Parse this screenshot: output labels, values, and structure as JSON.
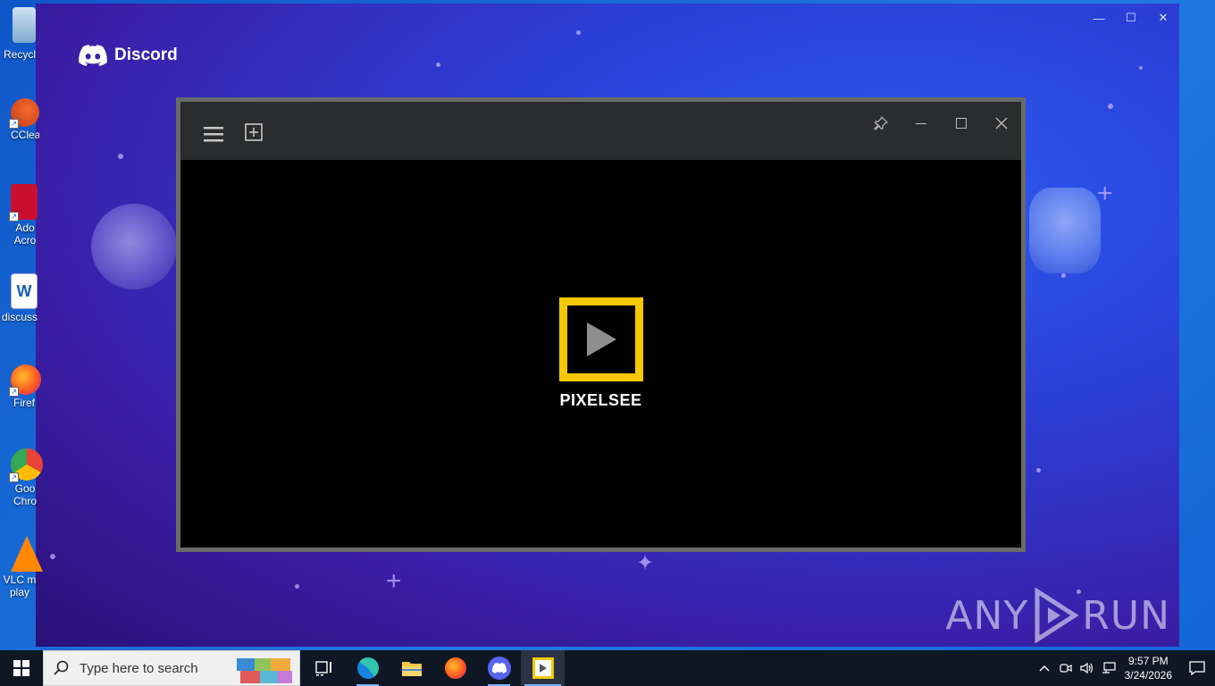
{
  "desktop": {
    "icons": [
      {
        "label": "Recycl",
        "icon": "recycle-bin-icon"
      },
      {
        "label": "CClea",
        "icon": "ccleaner-icon"
      },
      {
        "label": "Ado\nAcro",
        "icon": "acrobat-icon"
      },
      {
        "label": "discuss",
        "icon": "word-doc-icon"
      },
      {
        "label": "Firef",
        "icon": "firefox-icon"
      },
      {
        "label": "Goo\nChro",
        "icon": "chrome-icon"
      },
      {
        "label": "VLC m\nplay",
        "icon": "vlc-icon"
      }
    ]
  },
  "discord": {
    "brand": "Discord",
    "controls": {
      "minimize": "—",
      "maximize": "☐",
      "close": "✕"
    }
  },
  "pixelsee": {
    "name": "PIXELSEE",
    "accent": "#f5c800"
  },
  "watermark": {
    "text_left": "ANY",
    "text_right": "RUN"
  },
  "taskbar": {
    "search_placeholder": "Type here to search",
    "apps": [
      "task-view",
      "edge",
      "file-explorer",
      "firefox",
      "discord",
      "pixelsee"
    ],
    "clock": {
      "time": "9:57 PM",
      "date": "3/24/2026"
    }
  }
}
